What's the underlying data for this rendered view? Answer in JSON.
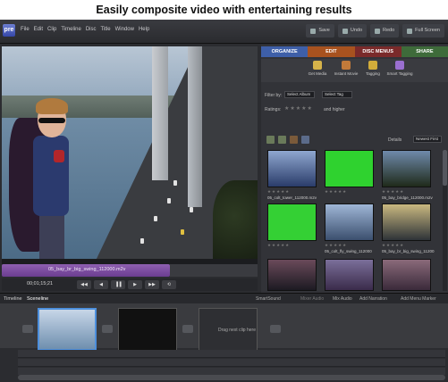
{
  "caption": "Easily composite video with entertaining results",
  "app": {
    "logo": "pre",
    "menu": [
      "File",
      "Edit",
      "Clip",
      "Timeline",
      "Disc",
      "Title",
      "Window",
      "Help"
    ],
    "top_buttons": [
      "Save",
      "Undo",
      "Redo",
      "Full Screen"
    ]
  },
  "preview": {
    "clip_name": "05_bay_br_big_swing_112000.m2v",
    "timecode": "00;01;15;21",
    "transport": [
      "◀◀",
      "◀",
      "▐▐",
      "▶",
      "▶▶",
      "⟲"
    ]
  },
  "panel": {
    "tabs": [
      "ORGANIZE",
      "EDIT",
      "DISC MENUS",
      "SHARE"
    ],
    "tools": [
      "Get Media",
      "Instant Movie",
      "Tagging",
      "Smart Tagging"
    ],
    "filter_label": "Filter by:",
    "filter_value": "Select Album",
    "tag_value": "Select Tag",
    "rating_label": "Ratings:",
    "rating_stars": "★★★★★",
    "higher_label": "and higher",
    "details_label": "Details",
    "sort_value": "Newest First",
    "thumbs": [
      {
        "caption": "05_colt_tower_112000.m2v",
        "stars": "★★★★★"
      },
      {
        "caption": "",
        "stars": "★★★★★"
      },
      {
        "caption": "05_bay_bridge_112000.m2v",
        "stars": "★★★★★"
      },
      {
        "caption": "",
        "stars": "★★★★★"
      },
      {
        "caption": "05_colt_fly_swing_112000",
        "stars": "★★★★★"
      },
      {
        "caption": "05_bay_br_big_swing_11200",
        "stars": "★★★★★"
      },
      {
        "caption": "",
        "stars": ""
      },
      {
        "caption": "",
        "stars": ""
      },
      {
        "caption": "",
        "stars": ""
      }
    ]
  },
  "timeline": {
    "tabs": [
      "Timeline",
      "Sceneline"
    ],
    "actions": [
      "SmartSound",
      "Mixer Audio",
      "Mix Audio",
      "Add Narration",
      "Add Menu Marker"
    ],
    "drop_text": "Drag next clip here"
  }
}
